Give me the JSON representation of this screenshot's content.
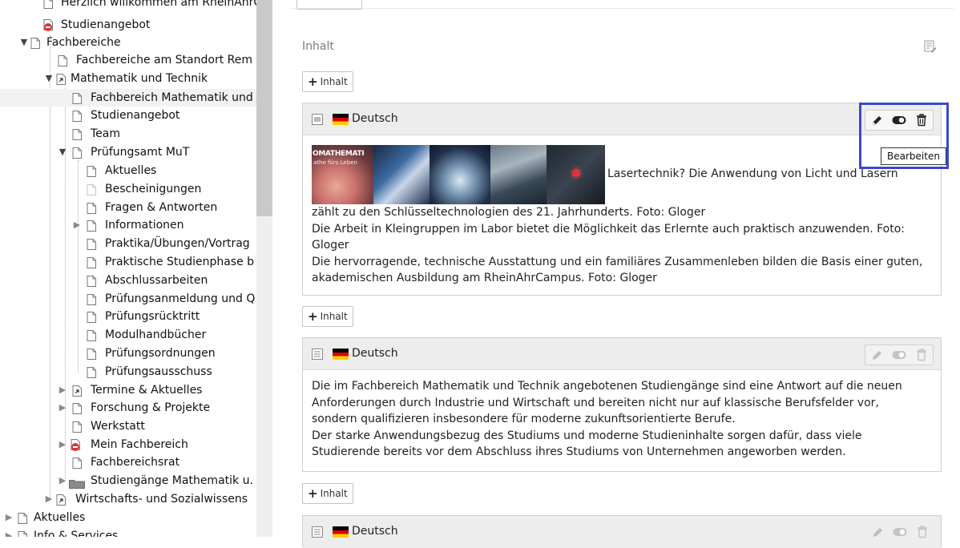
{
  "tree": {
    "items": [
      {
        "label": "Herzlich willkommen am RheinAhrC",
        "toggle": "",
        "icon": "page"
      },
      {
        "label": "Studienangebot",
        "toggle": "",
        "icon": "page-restricted"
      },
      {
        "label": "Fachbereiche",
        "toggle": "open",
        "icon": "page"
      },
      {
        "label": "Fachbereiche am Standort Rem",
        "toggle": "",
        "icon": "page"
      },
      {
        "label": "Mathematik und Technik",
        "toggle": "open",
        "icon": "page-shortcut"
      },
      {
        "label": "Fachbereich Mathematik und",
        "toggle": "",
        "icon": "page",
        "selected": true
      },
      {
        "label": "Studienangebot",
        "toggle": "",
        "icon": "page"
      },
      {
        "label": "Team",
        "toggle": "",
        "icon": "page"
      },
      {
        "label": "Prüfungsamt MuT",
        "toggle": "open",
        "icon": "page"
      },
      {
        "label": "Aktuelles",
        "toggle": "",
        "icon": "page"
      },
      {
        "label": "Bescheinigungen",
        "toggle": "",
        "icon": "page-hidden"
      },
      {
        "label": "Fragen & Antworten",
        "toggle": "",
        "icon": "page"
      },
      {
        "label": "Informationen",
        "toggle": "closed",
        "icon": "page"
      },
      {
        "label": "Praktika/Übungen/Vortrag",
        "toggle": "",
        "icon": "page"
      },
      {
        "label": "Praktische Studienphase b",
        "toggle": "",
        "icon": "page"
      },
      {
        "label": "Abschlussarbeiten",
        "toggle": "",
        "icon": "page"
      },
      {
        "label": "Prüfungsanmeldung und Q",
        "toggle": "",
        "icon": "page"
      },
      {
        "label": "Prüfungsrücktritt",
        "toggle": "",
        "icon": "page"
      },
      {
        "label": "Modulhandbücher",
        "toggle": "",
        "icon": "page"
      },
      {
        "label": "Prüfungsordnungen",
        "toggle": "",
        "icon": "page"
      },
      {
        "label": "Prüfungsausschuss",
        "toggle": "",
        "icon": "page"
      },
      {
        "label": "Termine & Aktuelles",
        "toggle": "closed",
        "icon": "page-shortcut"
      },
      {
        "label": "Forschung & Projekte",
        "toggle": "closed",
        "icon": "page"
      },
      {
        "label": "Werkstatt",
        "toggle": "",
        "icon": "page"
      },
      {
        "label": "Mein Fachbereich",
        "toggle": "closed",
        "icon": "page-restricted"
      },
      {
        "label": "Fachbereichsrat",
        "toggle": "",
        "icon": "page"
      },
      {
        "label": "Studiengänge Mathematik u.",
        "toggle": "closed",
        "icon": "folder"
      },
      {
        "label": "Wirtschafts- und Sozialwissens",
        "toggle": "closed",
        "icon": "page-shortcut"
      },
      {
        "label": "Aktuelles",
        "toggle": "closed",
        "icon": "page"
      },
      {
        "label": "Info & Services",
        "toggle": "closed",
        "icon": "page"
      }
    ]
  },
  "main": {
    "column_header": "Inhalt",
    "add_button_label": "Inhalt",
    "tooltip": "Bearbeiten",
    "elements": [
      {
        "language": "Deutsch",
        "actions_active": true,
        "image_text": "OMATHEMATI",
        "image_subtext": "athe fürs Leben",
        "lines": [
          "Lasertechnik? Die Anwendung von Licht und Lasern",
          "zählt zu den Schlüsseltechnologien des 21. Jahrhunderts. Foto: Gloger",
          "Die Arbeit in Kleingruppen im Labor bietet die Möglichkeit das Erlernte auch praktisch anzuwenden. Foto: Gloger",
          "Die hervorragende, technische Ausstattung und ein familiäres Zusammenleben bilden die Basis einer guten, akademischen Ausbildung am RheinAhrCampus. Foto: Gloger"
        ]
      },
      {
        "language": "Deutsch",
        "actions_active": false,
        "lines": [
          "Die im Fachbereich Mathematik und Technik angebotenen Studiengänge sind eine Antwort auf die neuen Anforderungen durch Industrie und Wirtschaft und bereiten nicht nur auf klassische Berufsfelder vor, sondern qualifizieren insbesondere für moderne zukunftsorientierte Berufe.",
          "Der starke Anwendungsbezug des Studiums und moderne Studieninhalte sorgen dafür, dass viele Studierende bereits vor dem Abschluss ihres Studiums von Unternehmen angeworben werden."
        ]
      },
      {
        "language": "Deutsch",
        "actions_active": false,
        "lines": []
      }
    ]
  },
  "colors": {
    "highlight": "#3b48cc",
    "restricted": "#d9363a",
    "flag_black": "#000000",
    "flag_red": "#dd0000",
    "flag_gold": "#ffce00"
  }
}
